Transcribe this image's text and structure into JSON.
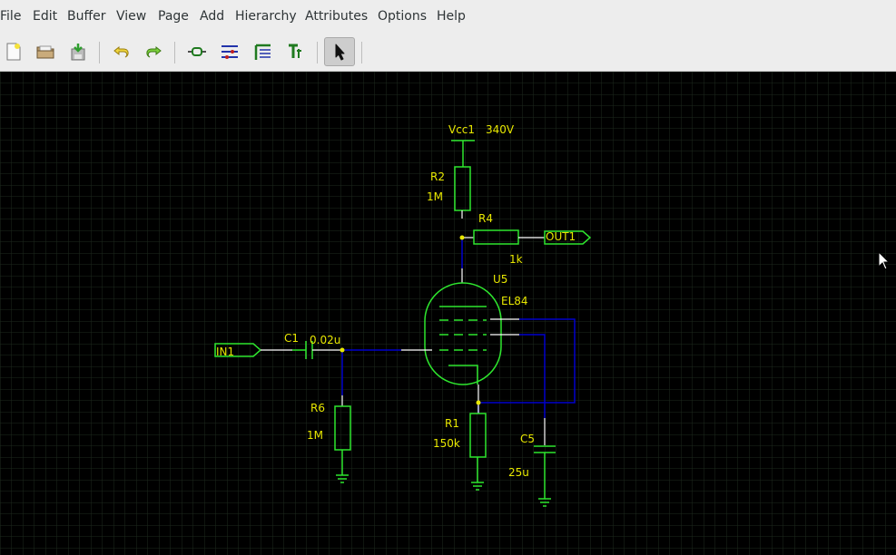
{
  "menu": [
    "File",
    "Edit",
    "Buffer",
    "View",
    "Page",
    "Add",
    "Hierarchy",
    "Attributes",
    "Options",
    "Help"
  ],
  "toolbar": {
    "buttons": [
      "new-file-icon",
      "open-folder-icon",
      "save-icon",
      "undo-icon",
      "redo-icon",
      "add-component-icon",
      "add-net-icon",
      "add-bus-icon",
      "add-text-icon",
      "select-pointer-icon"
    ],
    "active": "select-pointer-icon"
  },
  "colors": {
    "background": "#000000",
    "grid": "#1e2a1e",
    "component": "#2ee62e",
    "net": "#0000cc",
    "text": "#e8e800",
    "junction": "#e8e800",
    "pin": "#ffffff"
  },
  "schematic": {
    "vcc": "Vcc1",
    "vcc_value": "340V",
    "r2_ref": "R2",
    "r2_value": "1M",
    "r4_ref": "R4",
    "r4_value": "1k",
    "out_port": "OUT1",
    "u5_ref": "U5",
    "u5_value": "EL84",
    "in_port": "IN1",
    "c1_ref": "C1",
    "c1_value": "0.02u",
    "r6_ref": "R6",
    "r6_value": "1M",
    "r1_ref": "R1",
    "r1_value": "150k",
    "c5_ref": "C5",
    "c5_value": "25u"
  }
}
